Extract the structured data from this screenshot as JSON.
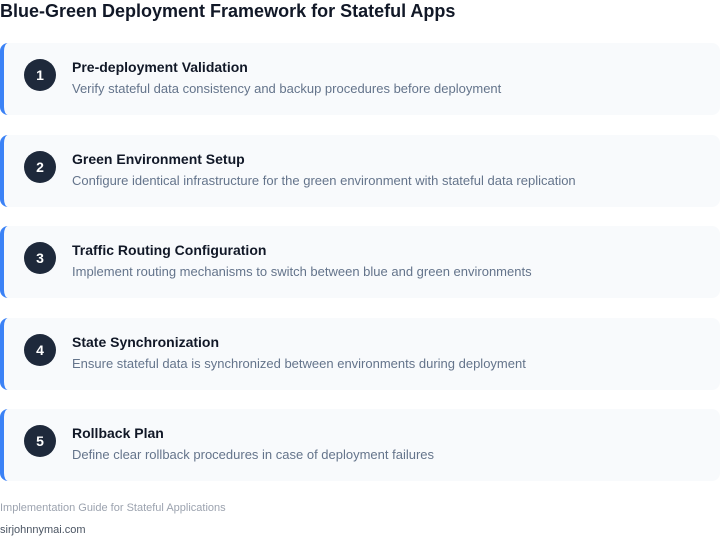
{
  "title": "Blue-Green Deployment Framework for Stateful Apps",
  "colors": {
    "accent": "#3b82f6",
    "badge": "#1e293b",
    "card_background": "#f8fafc"
  },
  "steps": [
    {
      "number": "1",
      "title": "Pre-deployment Validation",
      "description": "Verify stateful data consistency and backup procedures before deployment"
    },
    {
      "number": "2",
      "title": "Green Environment Setup",
      "description": "Configure identical infrastructure for the green environment with stateful data replication"
    },
    {
      "number": "3",
      "title": "Traffic Routing Configuration",
      "description": "Implement routing mechanisms to switch between blue and green environments"
    },
    {
      "number": "4",
      "title": "State Synchronization",
      "description": "Ensure stateful data is synchronized between environments during deployment"
    },
    {
      "number": "5",
      "title": "Rollback Plan",
      "description": "Define clear rollback procedures in case of deployment failures"
    }
  ],
  "footer": {
    "note": "Implementation Guide for Stateful Applications",
    "site": "sirjohnnymai.com"
  }
}
